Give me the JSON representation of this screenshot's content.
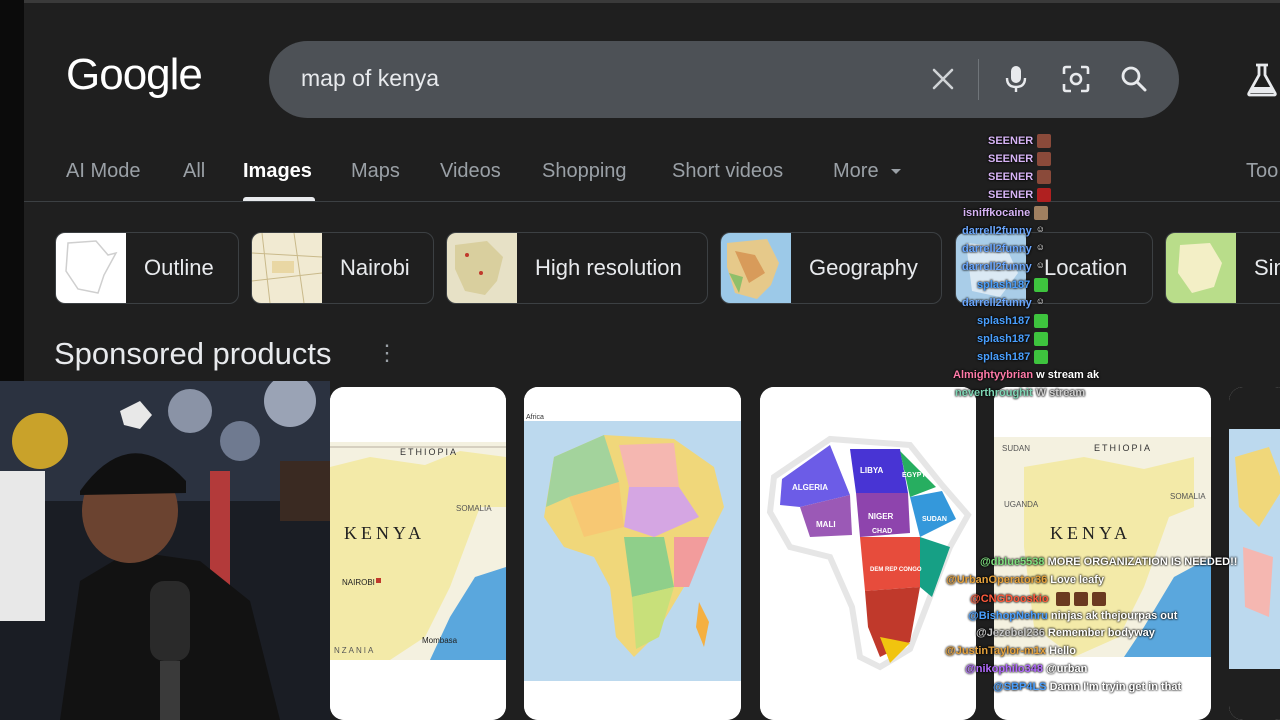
{
  "search": {
    "query": "map of kenya"
  },
  "logo": {
    "text": "Google"
  },
  "tabs": [
    "AI Mode",
    "All",
    "Images",
    "Maps",
    "Videos",
    "Shopping",
    "Short videos",
    "More",
    "Too"
  ],
  "chips": [
    "Outline",
    "Nairobi",
    "High resolution",
    "Geography",
    "Location",
    "Sim"
  ],
  "sponsored": {
    "title": "Sponsored products"
  },
  "cards": {
    "card1": {
      "header": "ETHIOPIA",
      "country": "KENYA",
      "right": "SOMALIA",
      "city": "NAIROBI",
      "port": "Mombasa",
      "bottom": "NZANIA"
    },
    "card2": {
      "header": "Africa"
    },
    "card3": {
      "labels": [
        "ALGERIA",
        "LIBYA",
        "EGYPT",
        "MALI",
        "NIGER",
        "CHAD",
        "SUDAN",
        "DEM REP CONGO"
      ]
    },
    "card4": {
      "sudan": "SUDAN",
      "header": "ETHIOPIA",
      "uganda": "UGANDA",
      "country": "KENYA",
      "right": "SOMALIA"
    }
  },
  "chat_top": [
    {
      "user": "SEENER",
      "color": "#d7b4f5",
      "msg": ""
    },
    {
      "user": "SEENER",
      "color": "#d7b4f5",
      "msg": ""
    },
    {
      "user": "SEENER",
      "color": "#d7b4f5",
      "msg": ""
    },
    {
      "user": "SEENER",
      "color": "#d7b4f5",
      "msg": ""
    },
    {
      "user": "isniffkocaine",
      "color": "#d7b4f5",
      "msg": ""
    },
    {
      "user": "darrell2funny",
      "color": "#6aa7ff",
      "msg": ""
    },
    {
      "user": "darrell2funny",
      "color": "#6aa7ff",
      "msg": ""
    },
    {
      "user": "darrell2funny",
      "color": "#6aa7ff",
      "msg": ""
    },
    {
      "user": "splash187",
      "color": "#4aa0ff",
      "msg": ""
    },
    {
      "user": "darrell2funny",
      "color": "#6aa7ff",
      "msg": ""
    },
    {
      "user": "splash187",
      "color": "#4aa0ff",
      "msg": ""
    },
    {
      "user": "splash187",
      "color": "#4aa0ff",
      "msg": ""
    },
    {
      "user": "splash187",
      "color": "#4aa0ff",
      "msg": ""
    },
    {
      "user": "Almightyybrian",
      "color": "#ff7aa8",
      "msg": "w stream ak"
    },
    {
      "user": "neverthroughit",
      "color": "#7fd6b5",
      "msg": "W stream"
    }
  ],
  "chat_bottom": [
    {
      "user": "@dblue5538",
      "color": "#7fe07f",
      "msg": "MORE ORGANIZATION IS NEEDED!!"
    },
    {
      "user": "@UrbanOperator36",
      "color": "#e6a23c",
      "msg": "Love leafy"
    },
    {
      "user": "@CNGDooskio",
      "color": "#ff5a3c",
      "msg": ""
    },
    {
      "user": "@BishopNehru",
      "color": "#4aa0ff",
      "msg": "ninjas ak thejourpas out"
    },
    {
      "user": "@Jezebel236",
      "color": "#c8c8c8",
      "msg": "Remember bodyway"
    },
    {
      "user": "@JustinTaylor-m1x",
      "color": "#e6a23c",
      "msg": "Hello"
    },
    {
      "user": "@nikophilo348",
      "color": "#b36bff",
      "msg": "@urban"
    },
    {
      "user": "@SBP4LS",
      "color": "#4aa0ff",
      "msg": "Damn I'm tryin get in that"
    }
  ],
  "colors": {
    "background": "#1f1f1f",
    "searchbar": "#4d5156",
    "text": "#e8eaed",
    "muted": "#9aa0a6"
  }
}
